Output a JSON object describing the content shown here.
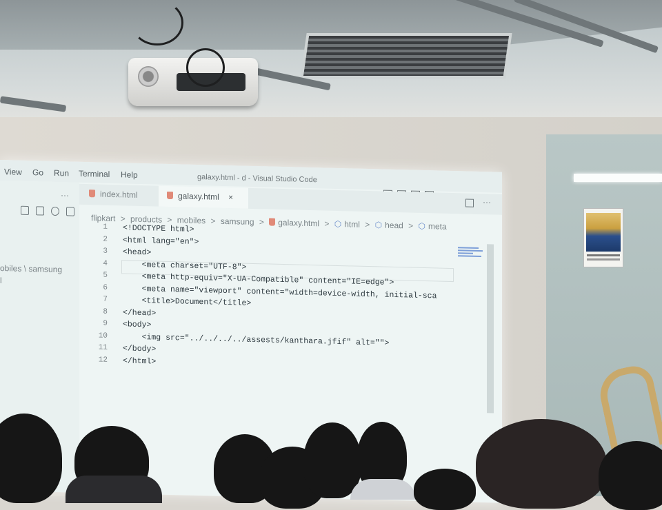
{
  "vscode": {
    "menu": [
      "View",
      "Go",
      "Run",
      "Terminal",
      "Help"
    ],
    "window_title": "galaxy.html - d - Visual Studio Code",
    "explorer_more": "···",
    "explorer_path_1": "obiles \\ samsung",
    "explorer_path_2": "l",
    "tabs": [
      {
        "label": "index.html",
        "active": false
      },
      {
        "label": "galaxy.html",
        "active": true,
        "close": "×"
      }
    ],
    "breadcrumb": [
      "flipkart",
      ">",
      "products",
      ">",
      "mobiles",
      ">",
      "samsung",
      ">",
      "galaxy.html",
      ">",
      "html",
      ">",
      "head",
      ">",
      "meta"
    ],
    "editor_more": "···",
    "code_lines": [
      {
        "n": "1",
        "text": "<!DOCTYPE html>"
      },
      {
        "n": "2",
        "text": "<html lang=\"en\">"
      },
      {
        "n": "3",
        "text": "<head>"
      },
      {
        "n": "4",
        "text": "    <meta charset=\"UTF-8\">"
      },
      {
        "n": "5",
        "text": "    <meta http-equiv=\"X-UA-Compatible\" content=\"IE=edge\">"
      },
      {
        "n": "6",
        "text": "    <meta name=\"viewport\" content=\"width=device-width, initial-sca"
      },
      {
        "n": "7",
        "text": "    <title>Document</title>"
      },
      {
        "n": "8",
        "text": "</head>"
      },
      {
        "n": "9",
        "text": "<body>"
      },
      {
        "n": "10",
        "text": "    <img src=\"../../../../assests/kanthara.jfif\" alt=\"\">"
      },
      {
        "n": "11",
        "text": "</body>"
      },
      {
        "n": "12",
        "text": "</html>"
      }
    ]
  },
  "colors": {
    "screen_bg": "#eef5f4",
    "html_icon": "#e08a78",
    "chair": "#c9a96b"
  }
}
